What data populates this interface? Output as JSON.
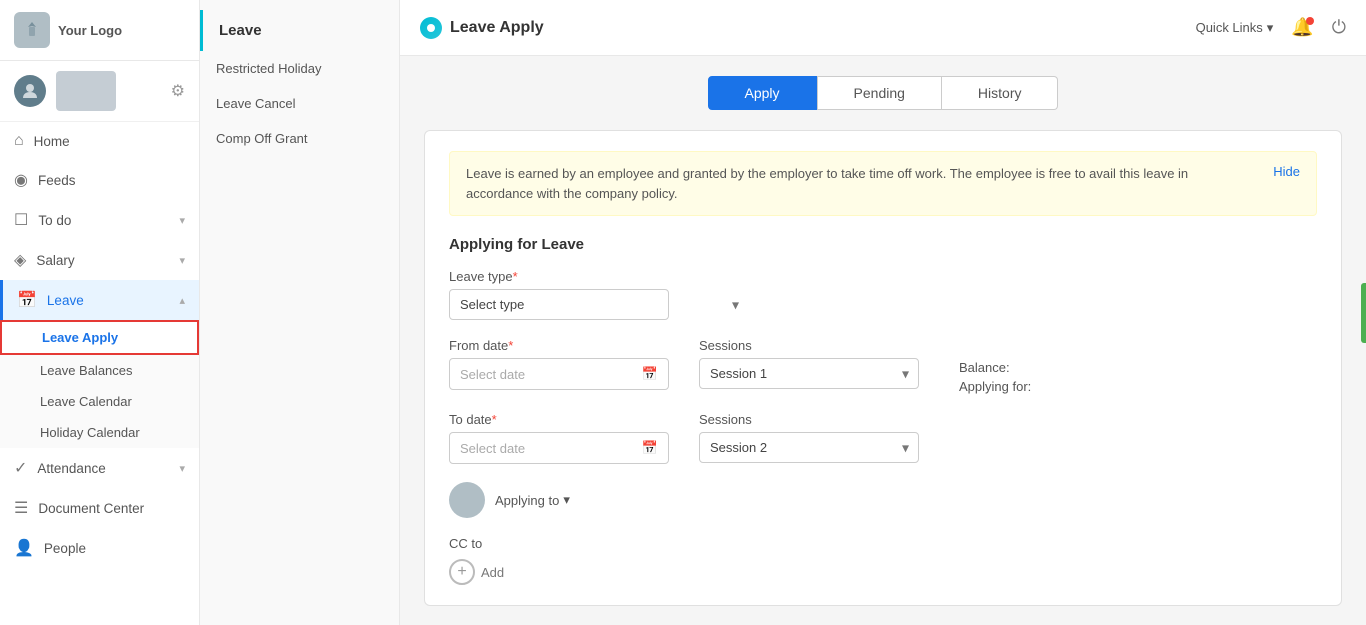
{
  "logo": {
    "text": "Your Logo"
  },
  "topbar": {
    "title": "Leave Apply",
    "quick_links": "Quick Links",
    "quick_links_arrow": "▾"
  },
  "sidebar": {
    "items": [
      {
        "id": "home",
        "label": "Home",
        "icon": "⌂"
      },
      {
        "id": "feeds",
        "label": "Feeds",
        "icon": "◎"
      },
      {
        "id": "todo",
        "label": "To do",
        "icon": "☐",
        "has_arrow": true
      },
      {
        "id": "salary",
        "label": "Salary",
        "icon": "◈",
        "has_arrow": true
      },
      {
        "id": "leave",
        "label": "Leave",
        "icon": "📅",
        "has_arrow": true,
        "active": true
      },
      {
        "id": "attendance",
        "label": "Attendance",
        "icon": "✓",
        "has_arrow": true
      },
      {
        "id": "document-center",
        "label": "Document Center",
        "icon": "☰"
      },
      {
        "id": "people",
        "label": "People",
        "icon": "👤"
      }
    ],
    "leave_sub": [
      {
        "id": "leave-apply",
        "label": "Leave Apply",
        "active": true
      },
      {
        "id": "leave-balances",
        "label": "Leave Balances"
      },
      {
        "id": "leave-calendar",
        "label": "Leave Calendar"
      },
      {
        "id": "holiday-calendar",
        "label": "Holiday Calendar"
      }
    ]
  },
  "secondary_sidebar": {
    "title": "Leave",
    "items": [
      {
        "id": "restricted-holiday",
        "label": "Restricted Holiday"
      },
      {
        "id": "leave-cancel",
        "label": "Leave Cancel"
      },
      {
        "id": "comp-off-grant",
        "label": "Comp Off Grant"
      }
    ]
  },
  "tabs": [
    {
      "id": "apply",
      "label": "Apply",
      "active": true
    },
    {
      "id": "pending",
      "label": "Pending"
    },
    {
      "id": "history",
      "label": "History"
    }
  ],
  "form": {
    "info_banner": "Leave is earned by an employee and granted by the employer to take time off work. The employee is free to avail this leave in accordance with the company policy.",
    "hide_label": "Hide",
    "section_title": "Applying for Leave",
    "leave_type_label": "Leave type",
    "leave_type_placeholder": "Select type",
    "from_date_label": "From date",
    "from_date_placeholder": "Select date",
    "sessions_label_1": "Sessions",
    "session1_options": [
      "Session 1",
      "Session 2"
    ],
    "session1_value": "Session 1",
    "balance_label": "Balance:",
    "applying_for_label": "Applying for:",
    "to_date_label": "To date",
    "to_date_placeholder": "Select date",
    "sessions_label_2": "Sessions",
    "session2_options": [
      "Session 1",
      "Session 2"
    ],
    "session2_value": "Session 2",
    "applying_to_label": "Applying to",
    "cc_to_label": "CC to",
    "add_label": "Add"
  }
}
